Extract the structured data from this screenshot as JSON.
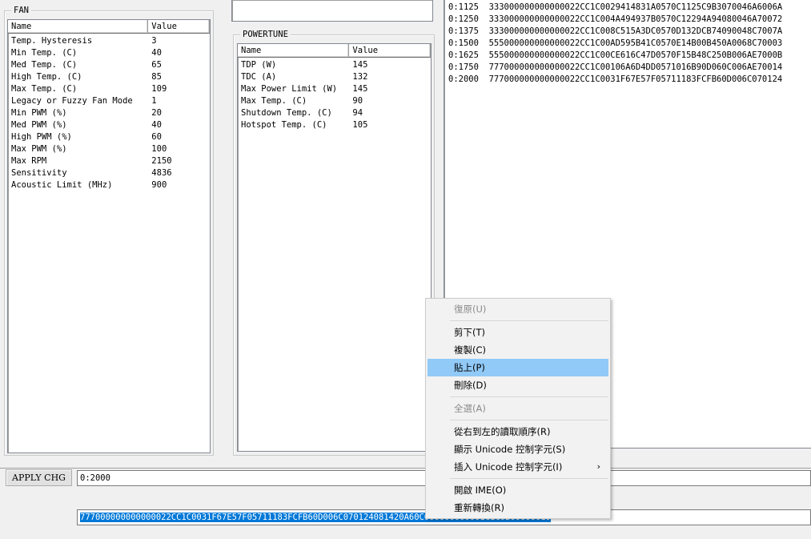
{
  "fan": {
    "title": "FAN",
    "columns": [
      "Name",
      "Value"
    ],
    "rows": [
      {
        "name": "Temp. Hysteresis",
        "value": "3"
      },
      {
        "name": "Min Temp. (C)",
        "value": "40"
      },
      {
        "name": "Med Temp. (C)",
        "value": "65"
      },
      {
        "name": "High Temp. (C)",
        "value": "85"
      },
      {
        "name": "Max Temp. (C)",
        "value": "109"
      },
      {
        "name": "Legacy or Fuzzy Fan Mode",
        "value": "1"
      },
      {
        "name": "Min PWM (%)",
        "value": "20"
      },
      {
        "name": "Med PWM (%)",
        "value": "40"
      },
      {
        "name": "High PWM (%)",
        "value": "60"
      },
      {
        "name": "Max PWM (%)",
        "value": "100"
      },
      {
        "name": "Max RPM",
        "value": "2150"
      },
      {
        "name": "Sensitivity",
        "value": "4836"
      },
      {
        "name": "Acoustic Limit (MHz)",
        "value": "900"
      }
    ]
  },
  "powertune": {
    "title": "POWERTUNE",
    "columns": [
      "Name",
      "Value"
    ],
    "rows": [
      {
        "name": "TDP (W)",
        "value": "145"
      },
      {
        "name": "TDC (A)",
        "value": "132"
      },
      {
        "name": "Max Power Limit (W)",
        "value": "145"
      },
      {
        "name": "Max Temp. (C)",
        "value": "90"
      },
      {
        "name": "Shutdown Temp. (C)",
        "value": "94"
      },
      {
        "name": "Hotspot Temp. (C)",
        "value": "105"
      }
    ]
  },
  "hex": {
    "lines": [
      "0:1125  333000000000000022CC1C0029414831A0570C1125C9B3070046A6006A",
      "0:1250  333000000000000022CC1C004A494937B0570C12294A94080046A70072",
      "0:1375  333000000000000022CC1C008C515A3DC0570D132DCB74090048C7007A",
      "0:1500  555000000000000022CC1C00AD595B41C0570E14B00B450A0068C70003",
      "0:1625  555000000000000022CC1C00CE616C47D0570F15B48C250B006AE7000B",
      "0:1750  777000000000000022CC1C00106A6D4DD0571016B90D060C006AE70014",
      "0:2000  777000000000000022CC1C0031F67E57F05711183FCFB60D006C070124"
    ]
  },
  "apply": {
    "button_label": "APPLY CHG",
    "address_value": "0:2000",
    "hex_value": "777000000000000022CC1C0031F67E57F05711183FCFB60D006C070124081420A60C000000000001C1C0B00000019"
  },
  "context_menu": {
    "items": [
      {
        "label": "復原(U)",
        "disabled": true
      },
      {
        "separator": true
      },
      {
        "label": "剪下(T)"
      },
      {
        "label": "複製(C)"
      },
      {
        "label": "貼上(P)",
        "highlighted": true
      },
      {
        "label": "刪除(D)"
      },
      {
        "separator": true
      },
      {
        "label": "全選(A)",
        "disabled": true
      },
      {
        "separator": true
      },
      {
        "label": "從右到左的讀取順序(R)"
      },
      {
        "label": "顯示 Unicode 控制字元(S)"
      },
      {
        "label": "插入 Unicode 控制字元(I)",
        "submenu": true
      },
      {
        "separator": true
      },
      {
        "label": "開啟 IME(O)"
      },
      {
        "label": "重新轉換(R)"
      }
    ],
    "submenu_arrow": "›"
  }
}
